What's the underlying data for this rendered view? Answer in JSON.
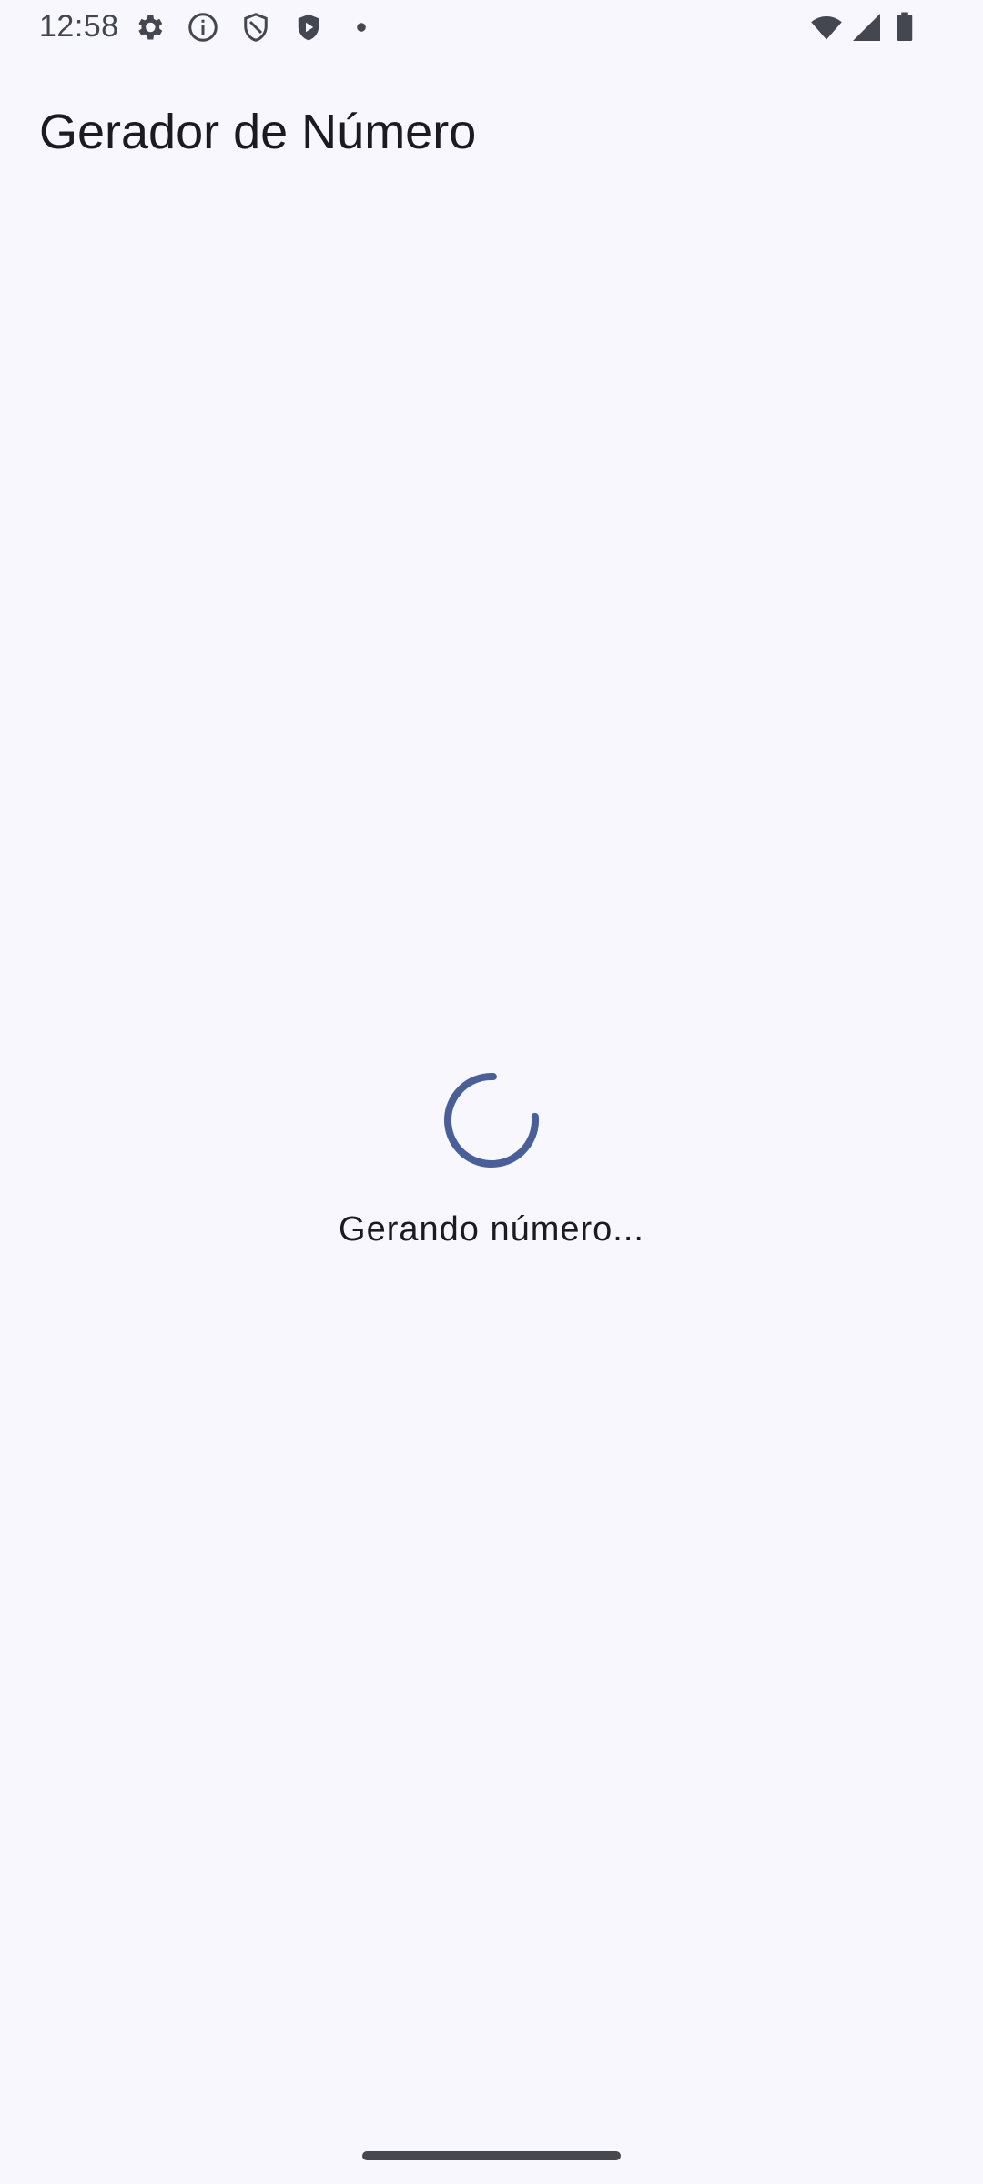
{
  "status_bar": {
    "time": "12:58",
    "icons": [
      "gear-icon",
      "info-icon",
      "shield-outline-icon",
      "shield-play-icon",
      "dot-icon",
      "wifi-icon",
      "signal-icon",
      "battery-icon"
    ]
  },
  "app_bar": {
    "title": "Gerador de Número"
  },
  "main": {
    "loading_text": "Gerando número...",
    "spinner_color": "#4a5f98"
  },
  "colors": {
    "background": "#f7f7fd",
    "text_primary": "#1b1b21",
    "status_icons": "#454750",
    "accent": "#4a5f98"
  }
}
